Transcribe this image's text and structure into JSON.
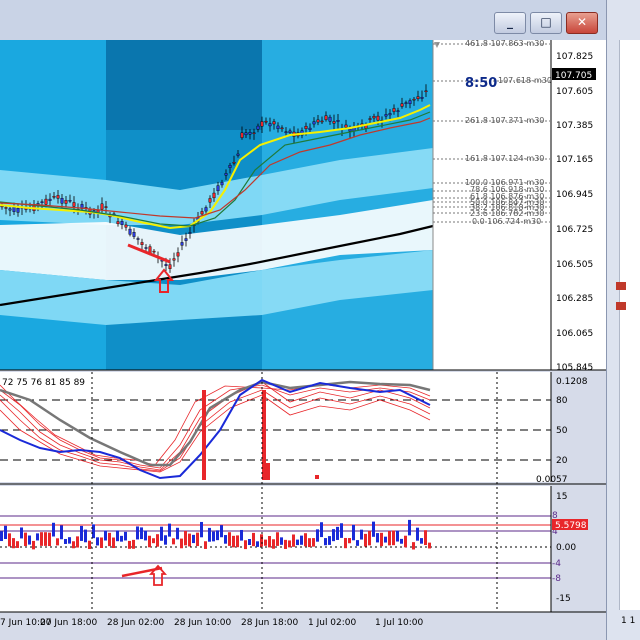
{
  "window": {
    "minimize_glyph": "_",
    "maximize_glyph": "□",
    "close_glyph": "✕"
  },
  "main_chart": {
    "price_axis": [
      "107.825",
      "107.605",
      "107.385",
      "107.165",
      "106.945",
      "106.725",
      "106.505",
      "106.285",
      "106.065",
      "105.845"
    ],
    "current_price": "107.705",
    "timer": "8:50",
    "fib_levels": [
      {
        "label": "461.8 107.863-m30"
      },
      {
        "label": "107.618-m30"
      },
      {
        "label": "261.8 107.371-m30"
      },
      {
        "label": "161.8 107.124-m30"
      },
      {
        "label": "100.0 106.971-m30"
      },
      {
        "label": "78.6 106.918-m30"
      },
      {
        "label": "61.8 106.876-m30"
      },
      {
        "label": "50.0 106.847-m30"
      },
      {
        "label": "38.2 106.818-m30"
      },
      {
        "label": "23.6 106.782-m30"
      },
      {
        "label": "0.0 106.724-m30"
      }
    ]
  },
  "stoch_panel": {
    "period_label": "72 75 76 81 85 89",
    "axis": [
      "0.1208",
      "80",
      "50",
      "20",
      "0.0057"
    ]
  },
  "osc_panel": {
    "axis": [
      "15",
      "8",
      "4",
      "0.00",
      "-4",
      "-8",
      "-15"
    ],
    "current_value": "5.5798"
  },
  "time_axis": [
    "7 Jun 10:00",
    "27 Jun 18:00",
    "28 Jun 02:00",
    "28 Jun 10:00",
    "28 Jun 18:00",
    "1 Jul 02:00",
    "1 Jul 10:00"
  ],
  "side_panel": {
    "labels": [
      "1 1"
    ]
  },
  "colors": {
    "chart_bg": "#1aa8e0",
    "price_marker": "#000000",
    "osc_marker": "#e8262a",
    "signal_arrow": "#e8262a"
  }
}
